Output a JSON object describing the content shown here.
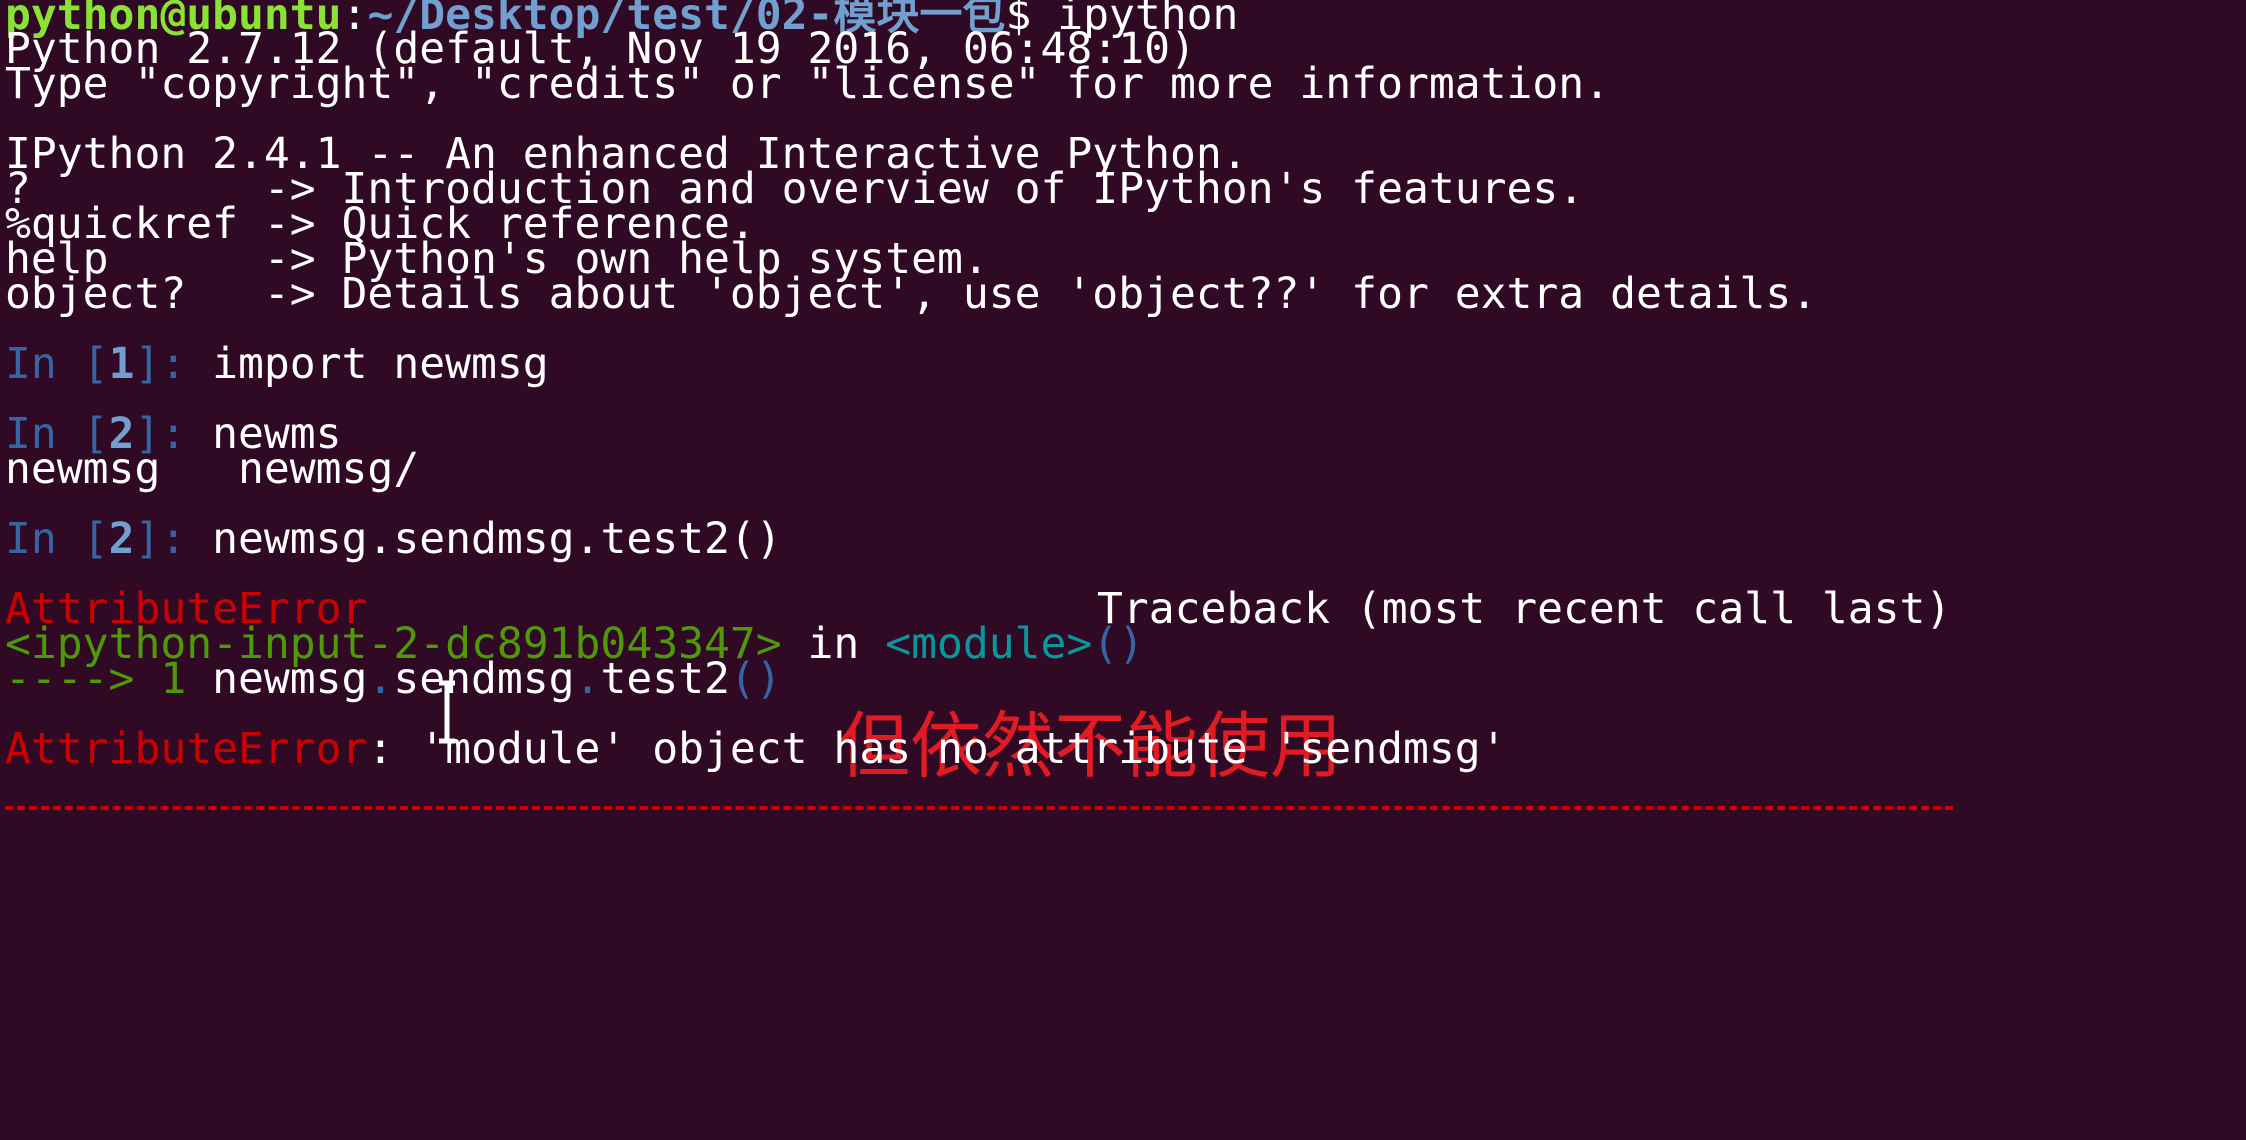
{
  "prompt": {
    "user_host": "python@ubuntu",
    "sep": ":",
    "path": "~/Desktop/test/02-模块一包",
    "symbol": "$",
    "command": " ipython"
  },
  "banner": [
    "Python 2.7.12 (default, Nov 19 2016, 06:48:10)",
    "Type \"copyright\", \"credits\" or \"license\" for more information.",
    "IPython 2.4.1 -- An enhanced Interactive Python.",
    "?         -> Introduction and overview of IPython's features.",
    "%quickref -> Quick reference.",
    "help      -> Python's own help system.",
    "object?   -> Details about 'object', use 'object??' for extra details."
  ],
  "cells": [
    {
      "prefix": "In [",
      "num": "1",
      "suffix": "]: ",
      "code": "import newmsg"
    },
    {
      "prefix": "In [",
      "num": "2",
      "suffix": "]: ",
      "code": "newms"
    },
    {
      "prefix": "In [",
      "num": "2",
      "suffix": "]: ",
      "code": "newmsg.sendmsg.test2()"
    }
  ],
  "completion": "newmsg   newmsg/",
  "annotation": "但依然不能使用",
  "traceback": {
    "error_name": "AttributeError",
    "header_right": "Traceback (most recent call last)",
    "input_ref": "<ipython-input-2-dc891b043347>",
    "in_word": " in ",
    "module_ref": "<module>",
    "paren_open": "(",
    "paren_close": ")",
    "arrow": "----> 1 ",
    "code_parts": [
      "newmsg",
      ".",
      "sendmsg",
      ".",
      "test2",
      "()"
    ],
    "message": ": 'module' object has no attribute 'sendmsg'"
  },
  "colors": {
    "background": "#300a24",
    "prompt_green": "#8ae234",
    "path_blue": "#729fcf",
    "error_red": "#cc0000",
    "annotation_red": "#e01b24"
  }
}
